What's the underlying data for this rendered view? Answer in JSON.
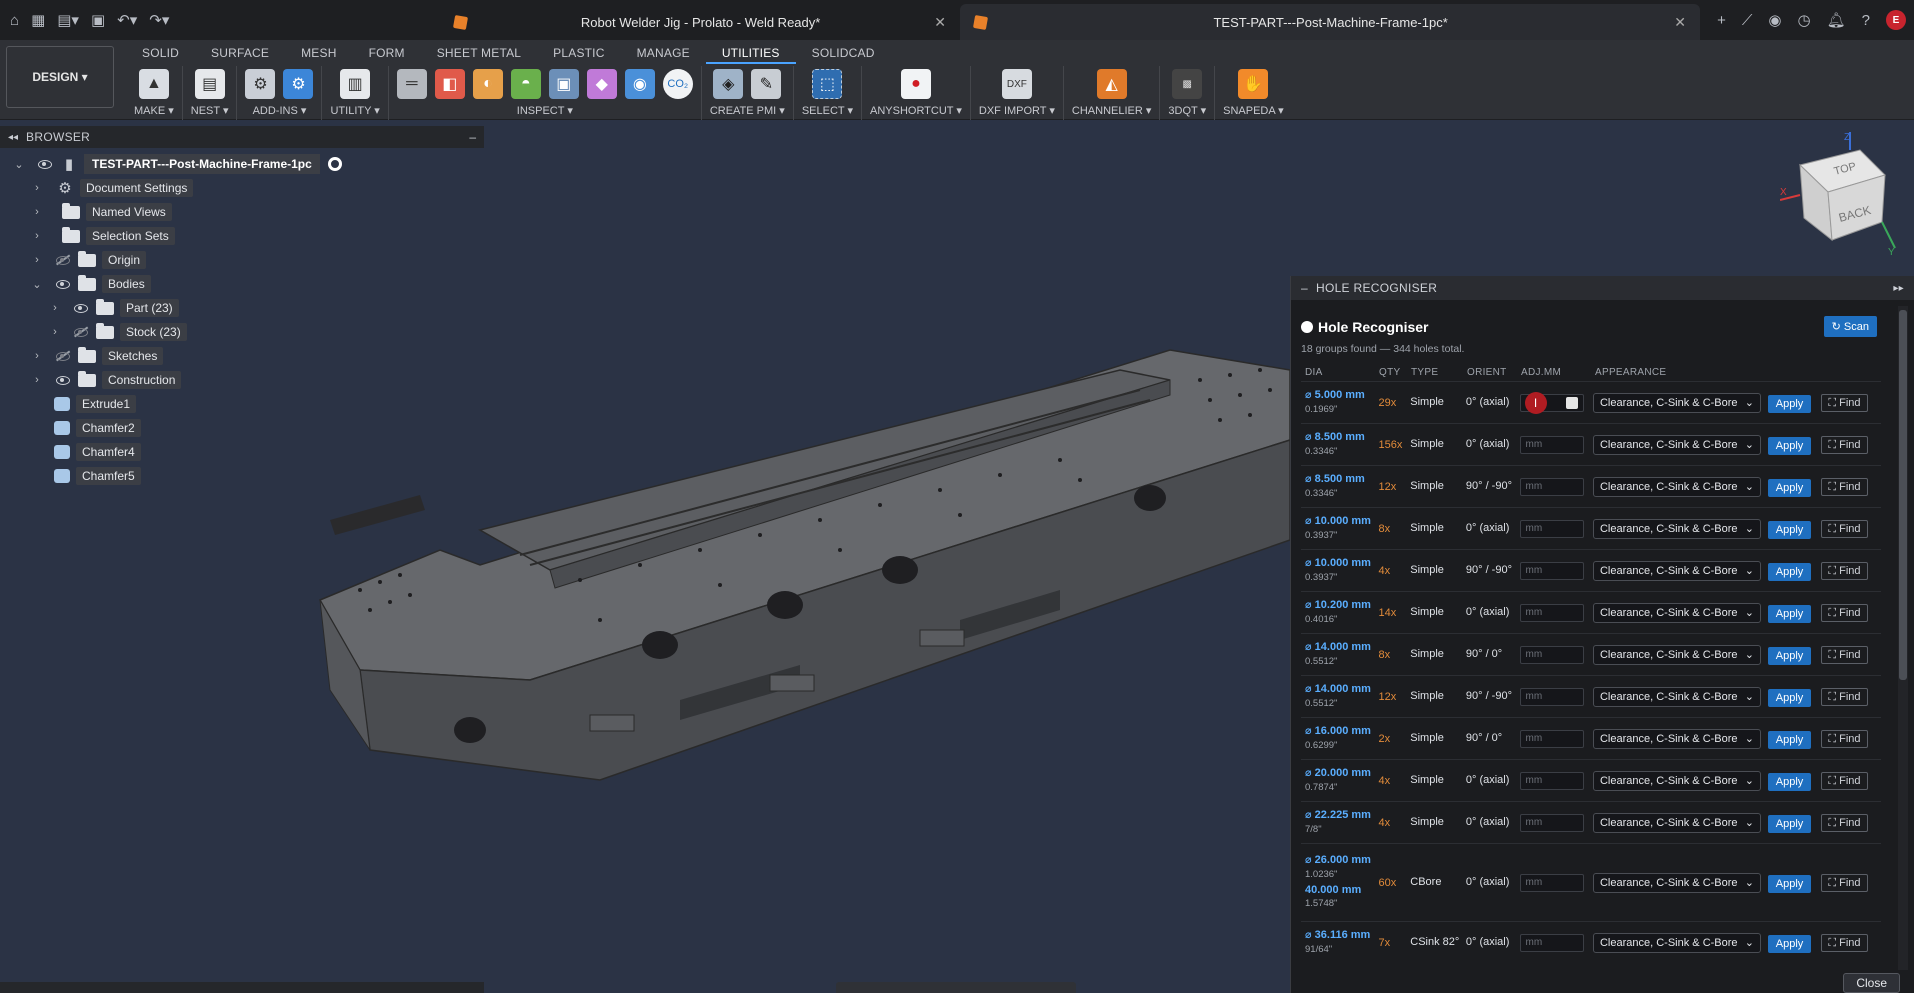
{
  "titlebar": {
    "tabs": [
      {
        "label": "Robot Welder Jig - Prolato - Weld Ready*"
      },
      {
        "label": "TEST-PART---Post-Machine-Frame-1pc*"
      }
    ],
    "avatar_initial": "E"
  },
  "toolbar": {
    "workspace": "DESIGN ▾",
    "tabs": [
      "SOLID",
      "SURFACE",
      "MESH",
      "FORM",
      "SHEET METAL",
      "PLASTIC",
      "MANAGE",
      "UTILITIES",
      "SOLIDCAD"
    ],
    "active_tab": "UTILITIES",
    "groups": [
      "MAKE ▾",
      "NEST ▾",
      "ADD-INS ▾",
      "UTILITY ▾",
      "INSPECT ▾",
      "CREATE PMI ▾",
      "SELECT ▾",
      "ANYSHORTCUT ▾",
      "DXF IMPORT ▾",
      "CHANNELIER ▾",
      "3DQT ▾",
      "SNAPEDA ▾"
    ]
  },
  "browser": {
    "title": "BROWSER",
    "root": "TEST-PART---Post-Machine-Frame-1pc",
    "items": [
      {
        "label": "Document Settings"
      },
      {
        "label": "Named Views"
      },
      {
        "label": "Selection Sets"
      },
      {
        "label": "Origin"
      },
      {
        "label": "Bodies"
      },
      {
        "label": "Part (23)"
      },
      {
        "label": "Stock (23)"
      },
      {
        "label": "Sketches"
      },
      {
        "label": "Construction"
      },
      {
        "label": "Extrude1"
      },
      {
        "label": "Chamfer2"
      },
      {
        "label": "Chamfer4"
      },
      {
        "label": "Chamfer5"
      }
    ]
  },
  "viewcube": {
    "top": "TOP",
    "back": "BACK",
    "z": "Z",
    "x": "X",
    "y": "Y"
  },
  "panel": {
    "header": "HOLE RECOGNISER",
    "title": "Hole Recogniser",
    "scan": "↻ Scan",
    "summary": "18 groups found — 344 holes total.",
    "columns": [
      "DIA",
      "QTY",
      "TYPE",
      "ORIENT",
      "ADJ.MM",
      "APPEARANCE"
    ],
    "placeholder": "mm",
    "appearance": "Clearance, C-Sink & C-Bore",
    "apply": "Apply",
    "find": "⛶ Find",
    "close": "Close",
    "rows": [
      {
        "dia": "⌀ 5.000 mm",
        "inch": "0.1969\"",
        "qty": "29x",
        "type": "Simple",
        "orient": "0° (axial)"
      },
      {
        "dia": "⌀ 8.500 mm",
        "inch": "0.3346\"",
        "qty": "156x",
        "type": "Simple",
        "orient": "0° (axial)"
      },
      {
        "dia": "⌀ 8.500 mm",
        "inch": "0.3346\"",
        "qty": "12x",
        "type": "Simple",
        "orient": "90° / -90°"
      },
      {
        "dia": "⌀ 10.000 mm",
        "inch": "0.3937\"",
        "qty": "8x",
        "type": "Simple",
        "orient": "0° (axial)"
      },
      {
        "dia": "⌀ 10.000 mm",
        "inch": "0.3937\"",
        "qty": "4x",
        "type": "Simple",
        "orient": "90° / -90°"
      },
      {
        "dia": "⌀ 10.200 mm",
        "inch": "0.4016\"",
        "qty": "14x",
        "type": "Simple",
        "orient": "0° (axial)"
      },
      {
        "dia": "⌀ 14.000 mm",
        "inch": "0.5512\"",
        "qty": "8x",
        "type": "Simple",
        "orient": "90° / 0°"
      },
      {
        "dia": "⌀ 14.000 mm",
        "inch": "0.5512\"",
        "qty": "12x",
        "type": "Simple",
        "orient": "90° / -90°"
      },
      {
        "dia": "⌀ 16.000 mm",
        "inch": "0.6299\"",
        "qty": "2x",
        "type": "Simple",
        "orient": "90° / 0°"
      },
      {
        "dia": "⌀ 20.000 mm",
        "inch": "0.7874\"",
        "qty": "4x",
        "type": "Simple",
        "orient": "0° (axial)"
      },
      {
        "dia": "⌀ 22.225 mm",
        "inch": "7/8\"",
        "qty": "4x",
        "type": "Simple",
        "orient": "0° (axial)"
      },
      {
        "dia": "⌀ 26.000 mm",
        "inch": "1.0236\"",
        "dia2": "40.000 mm",
        "inch2": "1.5748\"",
        "qty": "60x",
        "type": "CBore",
        "orient": "0° (axial)"
      },
      {
        "dia": "⌀ 36.116 mm",
        "inch": "91/64\"",
        "qty": "7x",
        "type": "CSink 82°",
        "orient": "0° (axial)"
      }
    ]
  }
}
